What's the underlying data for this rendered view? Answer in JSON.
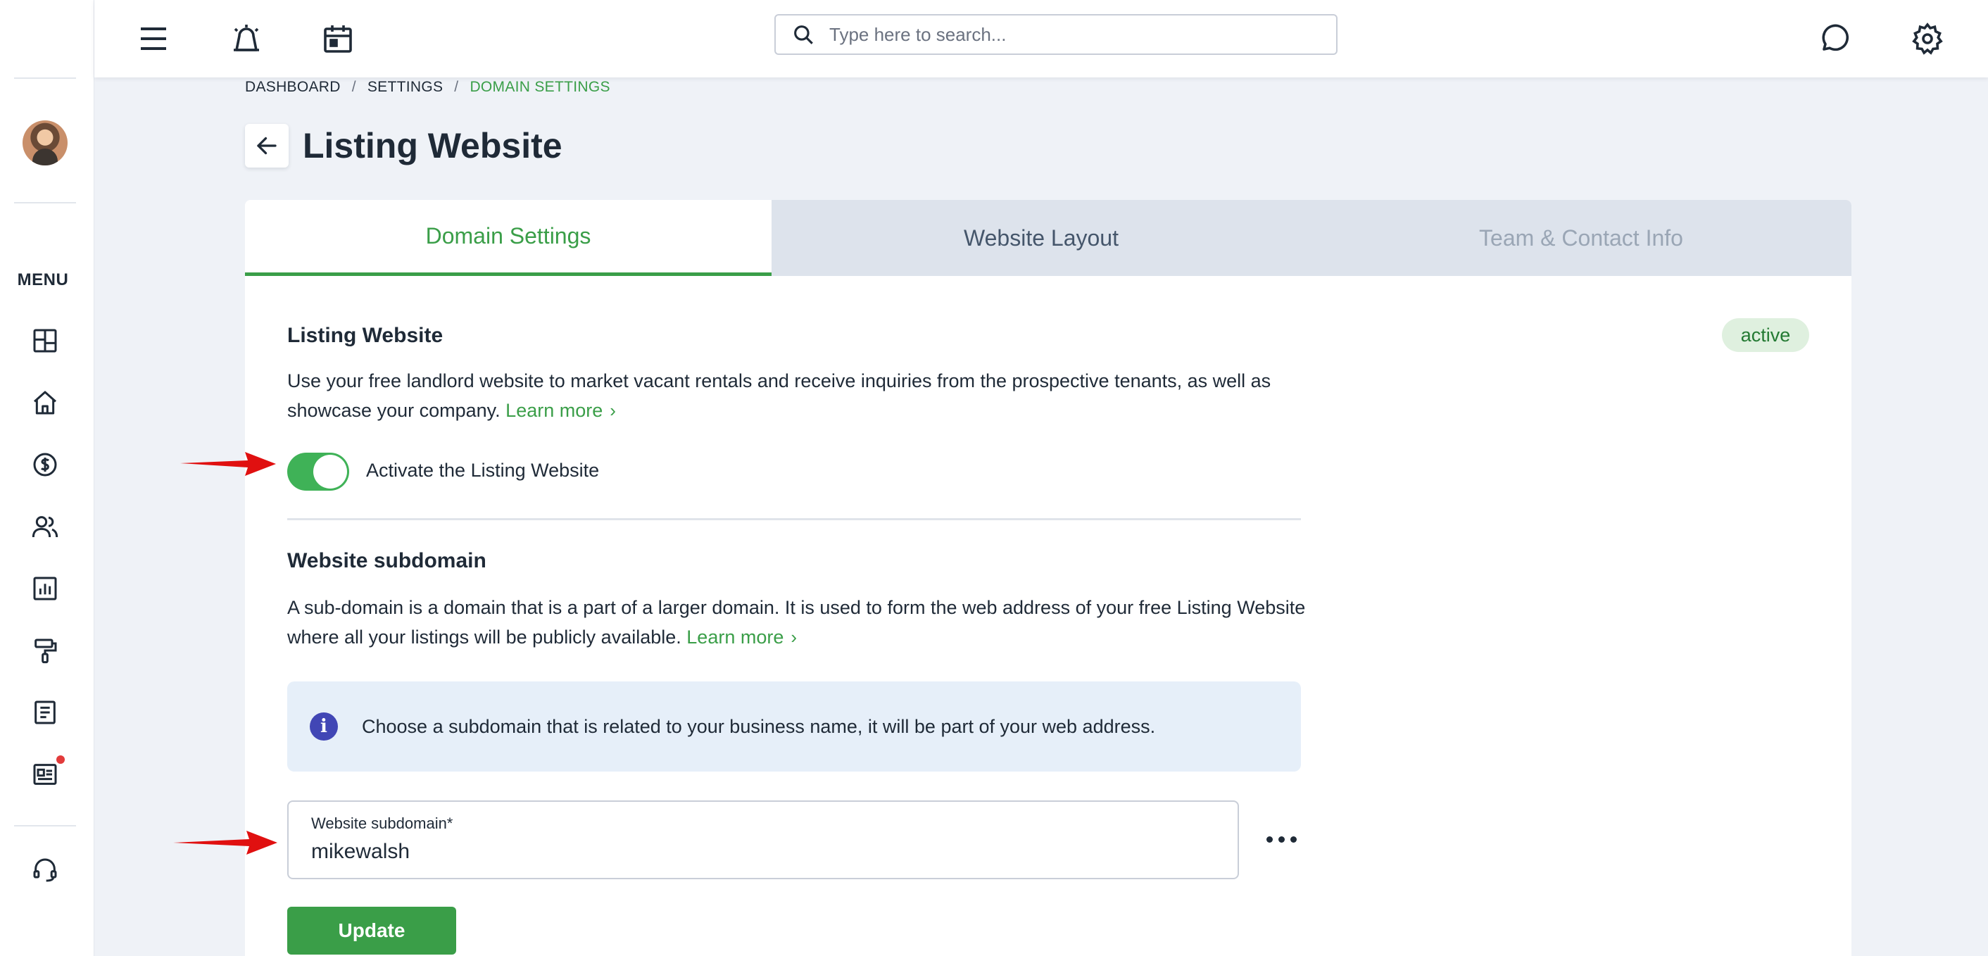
{
  "search": {
    "placeholder": "Type here to search..."
  },
  "sidebar": {
    "menu_label": "MENU"
  },
  "breadcrumb": {
    "items": [
      "DASHBOARD",
      "SETTINGS",
      "DOMAIN SETTINGS"
    ],
    "separator": "/"
  },
  "page": {
    "title": "Listing Website"
  },
  "tabs": [
    {
      "label": "Domain Settings",
      "active": true
    },
    {
      "label": "Website Layout",
      "active": false
    },
    {
      "label": "Team & Contact Info",
      "active": false
    }
  ],
  "listing": {
    "title": "Listing Website",
    "status": "active",
    "description": "Use your free landlord website to market vacant rentals and receive inquiries from the prospective tenants, as well as showcase your company.",
    "learn_more": "Learn more",
    "toggle_label": "Activate the Listing Website",
    "toggle_on": true
  },
  "subdomain": {
    "title": "Website subdomain",
    "description": "A sub-domain is a domain that is a part of a larger domain. It is used to form the web address of your free Listing Website where all your listings will be publicly available.",
    "learn_more": "Learn more",
    "info": "Choose a subdomain that is related to your business name, it will be part of your web address.",
    "field_label": "Website subdomain*",
    "field_value": "mikewalsh",
    "update_label": "Update"
  },
  "colors": {
    "accent": "#3a9e48",
    "toggle": "#3fb257",
    "info_icon": "#4146b5",
    "annotation_arrow": "#e01010",
    "notification_dot": "#e23b3b"
  }
}
